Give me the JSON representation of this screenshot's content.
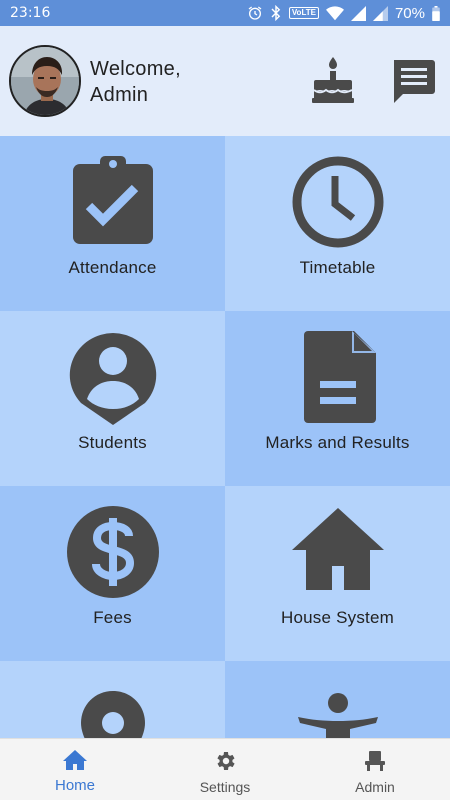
{
  "status_bar": {
    "time": "23:16",
    "network_badge": "VoLTE",
    "battery": "70%"
  },
  "header": {
    "welcome_line1": "Welcome,",
    "welcome_line2": "Admin",
    "cake_icon": "birthday-cake-icon",
    "message_icon": "message-icon"
  },
  "tiles": [
    {
      "label": "Attendance",
      "icon": "clipboard-check-icon"
    },
    {
      "label": "Timetable",
      "icon": "clock-icon"
    },
    {
      "label": "Students",
      "icon": "account-pin-icon"
    },
    {
      "label": "Marks and Results",
      "icon": "document-icon"
    },
    {
      "label": "Fees",
      "icon": "dollar-circle-icon"
    },
    {
      "label": "House System",
      "icon": "home-icon"
    },
    {
      "label": "",
      "icon": "location-pin-icon"
    },
    {
      "label": "",
      "icon": "accessibility-icon"
    }
  ],
  "bottom_nav": [
    {
      "label": "Home",
      "icon": "home-icon",
      "active": true
    },
    {
      "label": "Settings",
      "icon": "gear-icon",
      "active": false
    },
    {
      "label": "Admin",
      "icon": "admin-chair-icon",
      "active": false
    }
  ],
  "colors": {
    "status_bar": "#5e8fd8",
    "header_bg": "#e3ecfa",
    "tile_dark": "#9cc3f8",
    "tile_light": "#b4d3fb",
    "icon": "#4a4a4a",
    "accent": "#3b78d2"
  }
}
